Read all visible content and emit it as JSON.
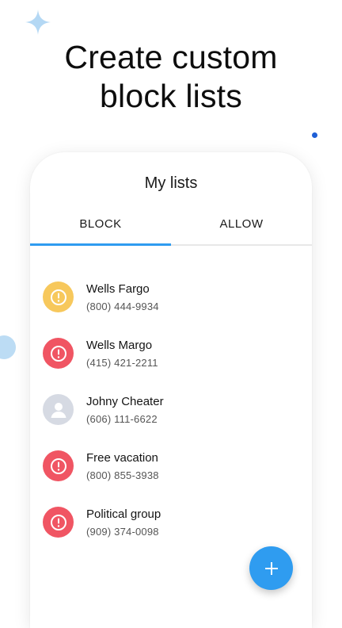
{
  "headline": {
    "line1": "Create custom",
    "line2": "block lists"
  },
  "card": {
    "title": "My lists",
    "tabs": [
      {
        "label": "BLOCK",
        "active": true
      },
      {
        "label": "ALLOW",
        "active": false
      }
    ]
  },
  "list": [
    {
      "name": "Wells Fargo",
      "phone": "(800) 444-9934",
      "icon": "warning-icon",
      "color": "#f7c85c"
    },
    {
      "name": "Wells Margo",
      "phone": "(415) 421-2211",
      "icon": "warning-icon",
      "color": "#f05563"
    },
    {
      "name": "Johny Cheater",
      "phone": "(606) 111-6622",
      "icon": "person-icon",
      "color": "#d6dae3"
    },
    {
      "name": "Free vacation",
      "phone": "(800) 855-3938",
      "icon": "warning-icon",
      "color": "#f05563"
    },
    {
      "name": "Political group",
      "phone": "(909) 374-0098",
      "icon": "warning-icon",
      "color": "#f05563"
    }
  ],
  "fab": {
    "icon": "plus-icon",
    "color": "#2f9cf0"
  },
  "colors": {
    "accent": "#2f9cf0",
    "warning_yellow": "#f7c85c",
    "warning_red": "#f05563",
    "neutral_gray": "#d6dae3"
  }
}
